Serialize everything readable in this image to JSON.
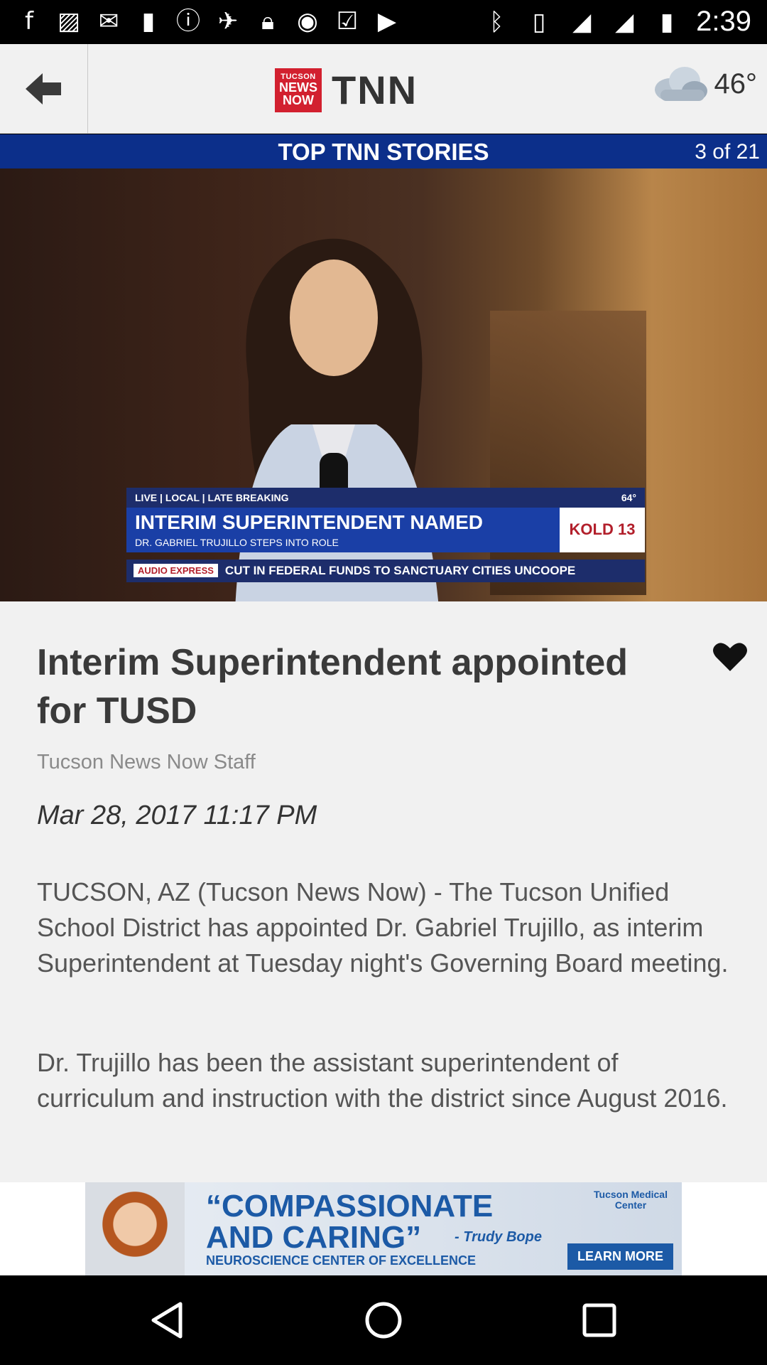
{
  "status_bar": {
    "time": "2:39",
    "left_icons": [
      "facebook-icon",
      "image-icon",
      "gmail-icon",
      "blank-icon",
      "info-icon",
      "fake-gps-icon",
      "lock-icon",
      "chat-icon",
      "inbox-icon",
      "briefcase-icon"
    ],
    "right_icons": [
      "bluetooth-icon",
      "vibrate-icon",
      "wifi-icon",
      "signal-icon",
      "battery-icon"
    ]
  },
  "header": {
    "logo_badge_line1": "TUCSON",
    "logo_badge_line2": "NEWS",
    "logo_badge_line3": "NOW",
    "logo_text": "TNN",
    "temperature": "46°"
  },
  "section": {
    "title": "TOP TNN STORIES",
    "counter": "3 of 21"
  },
  "hero": {
    "lower_third_tag": "LIVE | LOCAL | LATE BREAKING",
    "lower_third_temp": "64°",
    "lower_third_headline": "INTERIM SUPERINTENDENT NAMED",
    "lower_third_sub": "DR. GABRIEL TRUJILLO STEPS INTO ROLE",
    "lower_third_brand": "KOLD 13",
    "ticker_tag": "AUDIO EXPRESS",
    "ticker_text": "CUT IN FEDERAL FUNDS TO SANCTUARY CITIES UNCOOPE"
  },
  "article": {
    "headline": "Interim Superintendent appointed for TUSD",
    "byline": "Tucson News Now Staff",
    "date": "Mar 28, 2017 11:17 PM",
    "paragraphs": [
      "TUCSON, AZ (Tucson News Now) - The Tucson Unified School District has appointed Dr. Gabriel Trujillo, as interim Superintendent at Tuesday night's Governing Board meeting.",
      "Dr. Trujillo has been the assistant superintendent of curriculum and instruction with the district since August 2016."
    ]
  },
  "ad": {
    "title": "“COMPASSIONATE AND CARING”",
    "credit": "- Trudy Bope",
    "subtitle": "NEUROSCIENCE CENTER OF EXCELLENCE",
    "logo": "Tucson Medical Center",
    "cta": "LEARN MORE"
  },
  "colors": {
    "section_bar": "#0c2f8a",
    "logo_red": "#d2202f",
    "article_bg": "#f1f1f1"
  }
}
